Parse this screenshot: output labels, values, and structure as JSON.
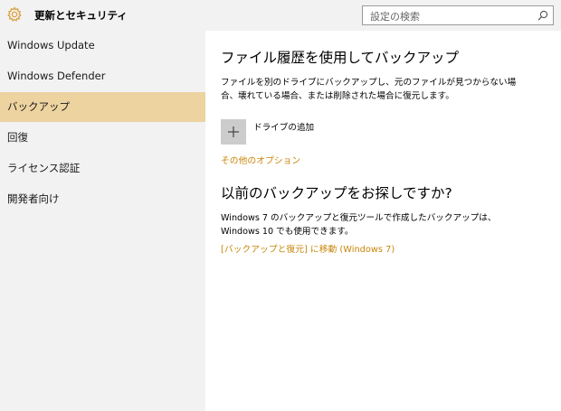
{
  "app": {
    "title": "更新とセキュリティ"
  },
  "search": {
    "placeholder": "設定の検索"
  },
  "sidebar": {
    "items": [
      {
        "label": "Windows Update",
        "selected": false
      },
      {
        "label": "Windows Defender",
        "selected": false
      },
      {
        "label": "バックアップ",
        "selected": true
      },
      {
        "label": "回復",
        "selected": false
      },
      {
        "label": "ライセンス認証",
        "selected": false
      },
      {
        "label": "開発者向け",
        "selected": false
      }
    ]
  },
  "main": {
    "backup_section": {
      "title": "ファイル履歴を使用してバックアップ",
      "description": "ファイルを別のドライブにバックアップし、元のファイルが見つからない場合、壊れている場合、または削除された場合に復元します。",
      "add_drive_label": "ドライブの追加",
      "more_options_link": "その他のオプション"
    },
    "older_backup_section": {
      "title": "以前のバックアップをお探しですか?",
      "description": "Windows 7 のバックアップと復元ツールで作成したバックアップは、Windows 10 でも使用できます。",
      "link": "[バックアップと復元] に移動 (Windows 7)"
    }
  },
  "colors": {
    "accent": "#c8860a",
    "selected_bg": "#ecd3a0",
    "sidebar_bg": "#f2f2f2",
    "icon_color": "#d9a040"
  },
  "icons": {
    "header": "gear-icon",
    "search": "search-icon",
    "add_drive": "plus-icon"
  }
}
